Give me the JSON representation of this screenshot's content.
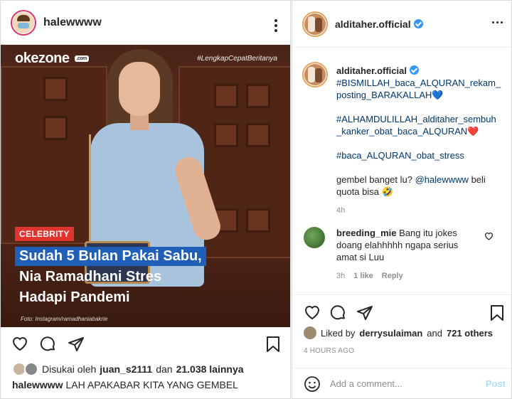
{
  "left": {
    "username": "halewwww",
    "post_image": {
      "brand": "okezone",
      "brand_suffix": ".com",
      "hashtag": "#LengkapCepatBeritanya",
      "category": "CELEBRITY",
      "headline_1": "Sudah 5 Bulan Pakai Sabu,",
      "headline_2": "Nia Ramadhani Stres",
      "headline_3": "Hadapi Pandemi",
      "credit": "Foto: Instagram/ramadhaniabakrie"
    },
    "liked_prefix": "Disukai oleh",
    "liked_user": "juan_s2111",
    "liked_mid": "dan",
    "liked_count": "21.038 lainnya",
    "caption_user": "halewwww",
    "caption_text": "LAH APAKABAR KITA YANG GEMBEL"
  },
  "right": {
    "username": "alditaher.official",
    "post": {
      "author": "alditaher.official",
      "line1": "#BISMILLAH_baca_ALQURAN_rekam_",
      "line2": "posting_BARAKALLAH",
      "line2_emoji": "💙",
      "line3": "#ALHAMDULILLAH_alditaher_sembuh",
      "line4": "_kanker_obat_baca_ALQURAN",
      "line4_emoji": "❤️",
      "line5": "#baca_ALQURAN_obat_stress",
      "line6a": "gembel banget lu?",
      "line6_mention": "@halewwww",
      "line6b": "beli",
      "line7": "quota bisa",
      "line7_emoji": "🤣",
      "time": "4h"
    },
    "comment": {
      "user": "breeding_mie",
      "text1": "Bang itu jokes",
      "text2": "doang elahhhhh ngapa serius",
      "text3": "amat si Luu",
      "time": "3h",
      "likes": "1 like",
      "reply": "Reply"
    },
    "liked_prefix": "Liked by",
    "liked_user": "derrysulaiman",
    "liked_mid": "and",
    "liked_count": "721 others",
    "ago": "4 HOURS AGO",
    "add_placeholder": "Add a comment...",
    "post_button": "Post"
  }
}
